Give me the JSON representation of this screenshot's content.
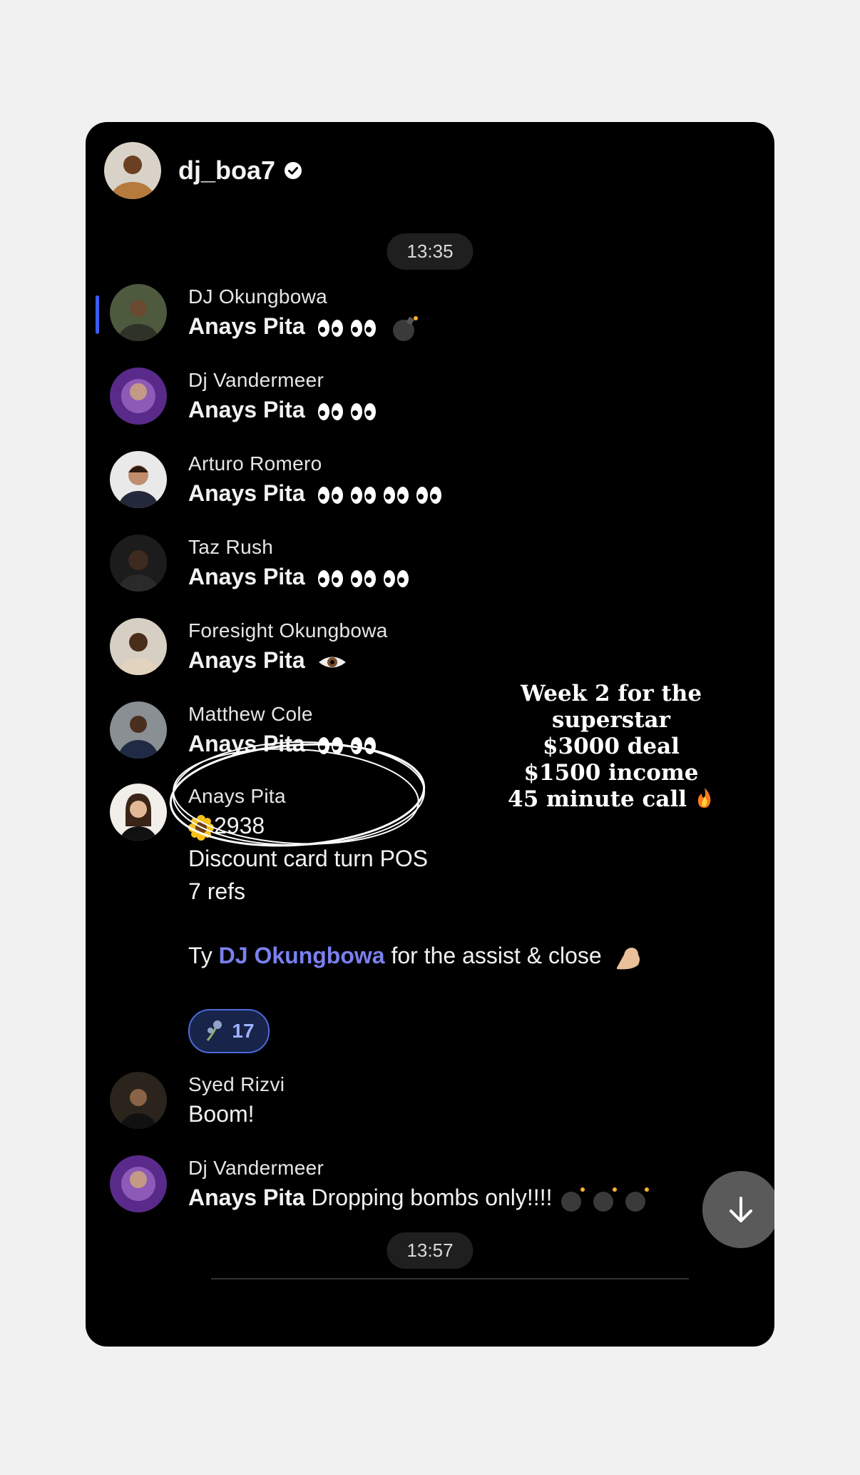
{
  "header": {
    "username": "dj_boa7"
  },
  "times": {
    "start": "13:35",
    "end": "13:57"
  },
  "messages": [
    {
      "name": "DJ Okungbowa",
      "mention": "Anays Pita"
    },
    {
      "name": "Dj Vandermeer",
      "mention": "Anays Pita"
    },
    {
      "name": "Arturo Romero",
      "mention": "Anays Pita"
    },
    {
      "name": "Taz Rush",
      "mention": "Anays Pita"
    },
    {
      "name": "Foresight Okungbowa",
      "mention": "Anays Pita"
    },
    {
      "name": "Matthew Cole",
      "mention": "Anays Pita"
    },
    {
      "name": "Anays Pita",
      "line1": "2938",
      "line2": "Discount card turn POS",
      "line3": "7 refs",
      "line4_pre": "Ty ",
      "line4_link": "DJ Okungbowa",
      "line4_post": " for the assist & close"
    },
    {
      "name": "Syed Rizvi",
      "text": "Boom!"
    },
    {
      "name": "Dj Vandermeer",
      "mention": "Anays Pita",
      "text": " Dropping bombs only!!!!"
    }
  ],
  "reaction": {
    "count": "17"
  },
  "overlay": {
    "line1": "Week 2 for the superstar",
    "line2": "$3000 deal",
    "line3": "$1500 income",
    "line4": "45 minute call"
  },
  "colors": {
    "background": "#000000",
    "mention_link": "#7a80ee",
    "reaction_border": "#4a6ad8",
    "unread_indicator": "#3a5df0"
  }
}
